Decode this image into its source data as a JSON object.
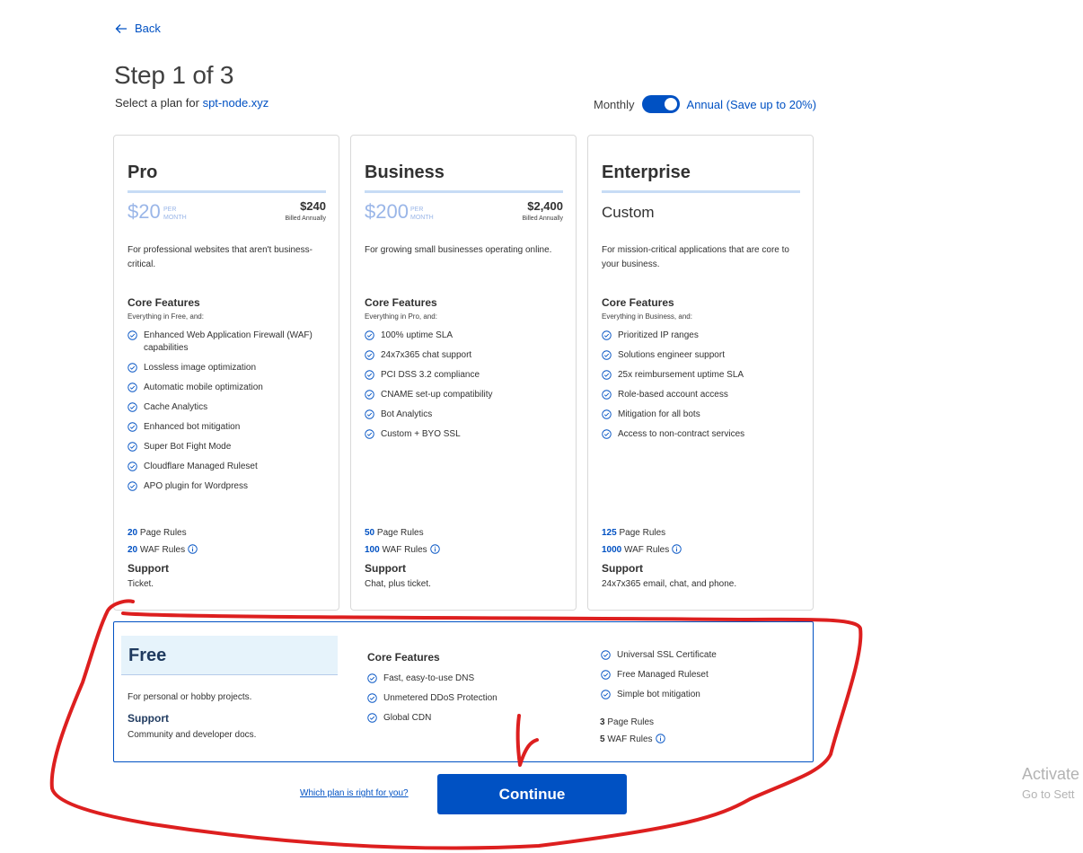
{
  "header": {
    "back_label": "Back",
    "step_title": "Step 1 of 3",
    "subtitle_prefix": "Select a plan for",
    "domain": "spt-node.xyz"
  },
  "billing": {
    "monthly_label": "Monthly",
    "annual_label": "Annual (Save up to 20%)",
    "annual_selected": true
  },
  "plans": [
    {
      "name": "Pro",
      "price": "$20",
      "per_line1": "PER",
      "per_line2": "MONTH",
      "annual_price": "$240",
      "billed": "Billed Annually",
      "description": "For professional websites that aren't business-critical.",
      "core_title": "Core Features",
      "core_sub": "Everything in Free, and:",
      "features": [
        "Enhanced Web Application Firewall (WAF) capabilities",
        "Lossless image optimization",
        "Automatic mobile optimization",
        "Cache Analytics",
        "Enhanced bot mitigation",
        "Super Bot Fight Mode",
        "Cloudflare Managed Ruleset",
        "APO plugin for Wordpress"
      ],
      "page_rules_count": "20",
      "page_rules_label": "Page Rules",
      "waf_rules_count": "20",
      "waf_rules_label": "WAF Rules",
      "support_title": "Support",
      "support_text": "Ticket."
    },
    {
      "name": "Business",
      "price": "$200",
      "per_line1": "PER",
      "per_line2": "MONTH",
      "annual_price": "$2,400",
      "billed": "Billed Annually",
      "description": "For growing small businesses operating online.",
      "core_title": "Core Features",
      "core_sub": "Everything in Pro, and:",
      "features": [
        "100% uptime SLA",
        "24x7x365 chat support",
        "PCI DSS 3.2 compliance",
        "CNAME set-up compatibility",
        "Bot Analytics",
        "Custom + BYO SSL"
      ],
      "page_rules_count": "50",
      "page_rules_label": "Page Rules",
      "waf_rules_count": "100",
      "waf_rules_label": "WAF Rules",
      "support_title": "Support",
      "support_text": "Chat, plus ticket."
    },
    {
      "name": "Enterprise",
      "custom_label": "Custom",
      "description": "For mission-critical applications that are core to your business.",
      "core_title": "Core Features",
      "core_sub": "Everything in Business, and:",
      "features": [
        "Prioritized IP ranges",
        "Solutions engineer support",
        "25x reimbursement uptime SLA",
        "Role-based account access",
        "Mitigation for all bots",
        "Access to non-contract services"
      ],
      "page_rules_count": "125",
      "page_rules_label": "Page Rules",
      "waf_rules_count": "1000",
      "waf_rules_label": "WAF Rules",
      "support_title": "Support",
      "support_text": "24x7x365 email, chat, and phone."
    }
  ],
  "free_plan": {
    "name": "Free",
    "description": "For personal or hobby projects.",
    "support_title": "Support",
    "support_text": "Community and developer docs.",
    "core_title": "Core Features",
    "features_a": [
      "Fast, easy-to-use DNS",
      "Unmetered DDoS Protection",
      "Global CDN"
    ],
    "features_b": [
      "Universal SSL Certificate",
      "Free Managed Ruleset",
      "Simple bot mitigation"
    ],
    "page_rules_count": "3",
    "page_rules_label": "Page Rules",
    "waf_rules_count": "5",
    "waf_rules_label": "WAF Rules"
  },
  "footer": {
    "which_plan_link": "Which plan is right for you?",
    "continue_label": "Continue"
  },
  "watermark": {
    "line1": "Activate",
    "line2": "Go to Sett"
  },
  "colors": {
    "accent": "#0051c3",
    "annotation": "#dd1f1f",
    "price_light": "#9ab6e8"
  },
  "icons": [
    "arrow-left-icon",
    "check-circle-icon",
    "info-icon"
  ]
}
